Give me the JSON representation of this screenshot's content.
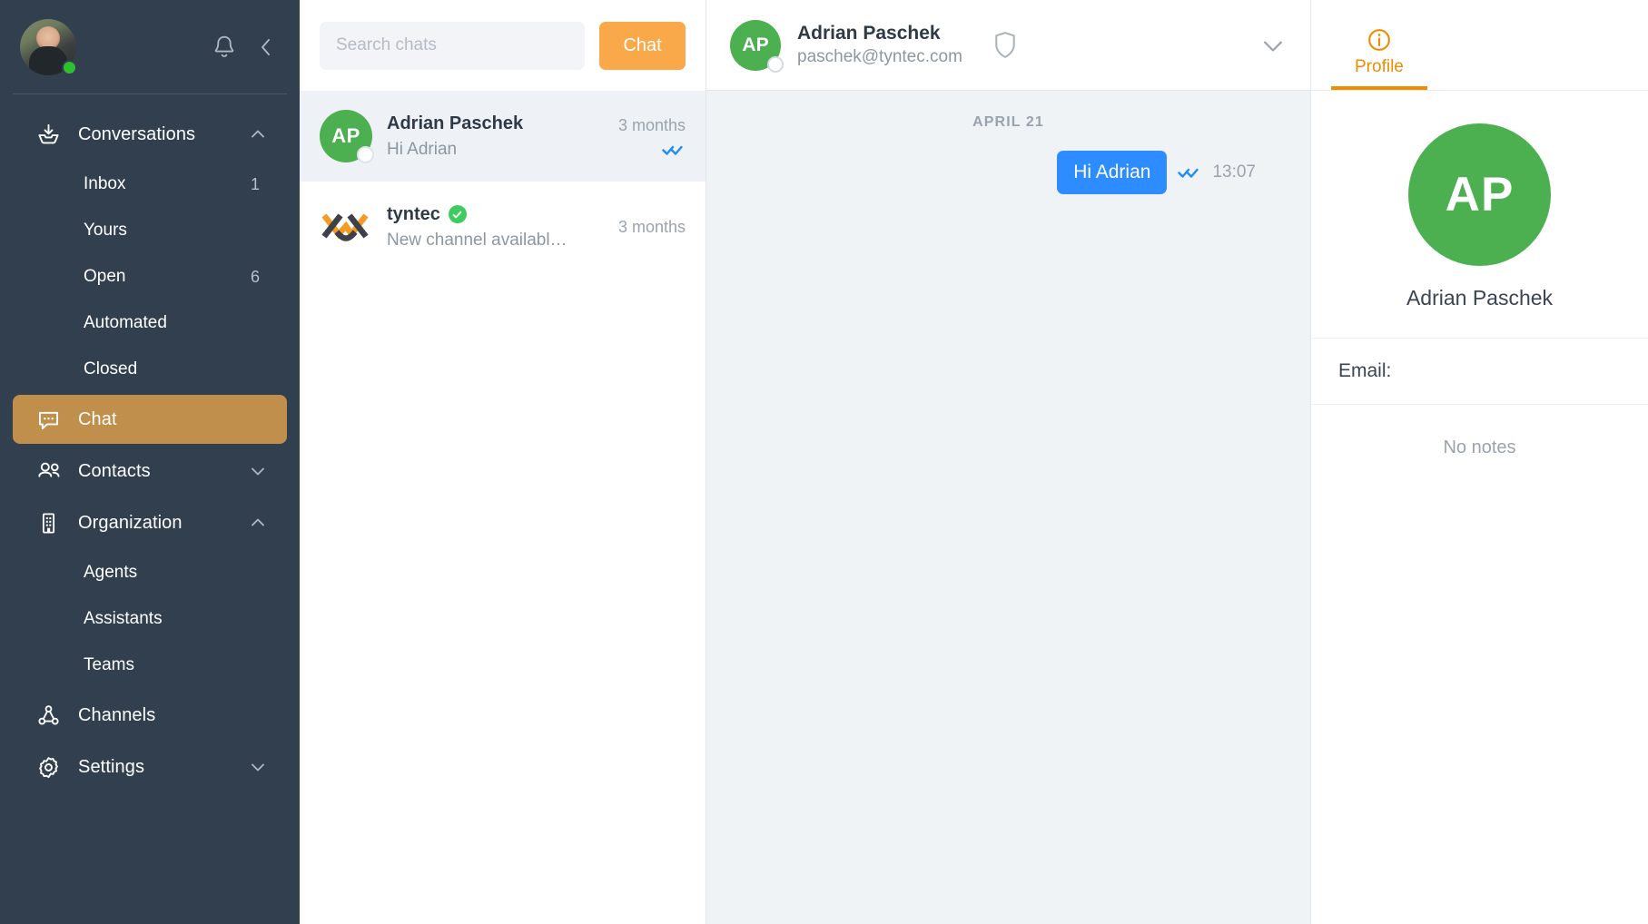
{
  "sidebar": {
    "user": {
      "presence": "online"
    },
    "icons": {
      "bell": "bell-icon",
      "collapse": "chevron-left-icon"
    },
    "groups": [
      {
        "label": "Conversations",
        "icon": "inbox-download-icon",
        "expanded": true,
        "children": [
          {
            "label": "Inbox",
            "count": "1"
          },
          {
            "label": "Yours",
            "count": ""
          },
          {
            "label": "Open",
            "count": "6"
          },
          {
            "label": "Automated",
            "count": ""
          },
          {
            "label": "Closed",
            "count": ""
          }
        ]
      }
    ],
    "items": [
      {
        "label": "Chat",
        "icon": "chat-bubble-icon",
        "active": true
      },
      {
        "label": "Contacts",
        "icon": "people-icon",
        "chevron": "down"
      },
      {
        "label": "Organization",
        "icon": "building-icon",
        "chevron": "up"
      }
    ],
    "org_children": [
      {
        "label": "Agents"
      },
      {
        "label": "Assistants"
      },
      {
        "label": "Teams"
      }
    ],
    "bottom_items": [
      {
        "label": "Channels",
        "icon": "channels-icon",
        "chevron": ""
      },
      {
        "label": "Settings",
        "icon": "gear-icon",
        "chevron": "down"
      }
    ],
    "active_color": "#C08F4C",
    "background": "#323F4F"
  },
  "chatlist": {
    "search_placeholder": "Search chats",
    "search_value": "",
    "new_chat_label": "Chat",
    "new_chat_color": "#F9A949",
    "items": [
      {
        "initials": "AP",
        "name": "Adrian Paschek",
        "preview": "Hi Adrian",
        "time": "3 months",
        "selected": true,
        "read_receipt": "double-check-blue",
        "verified": false,
        "avatar_color": "#4CAF50"
      },
      {
        "initials": "",
        "name": "tyntec",
        "preview": "New channel availabl…",
        "time": "3 months",
        "selected": false,
        "read_receipt": "",
        "verified": true,
        "avatar_color": ""
      }
    ]
  },
  "conversation": {
    "header": {
      "initials": "AP",
      "name": "Adrian Paschek",
      "subtitle": "paschek@tyntec.com",
      "shield_icon": "shield-icon",
      "chevron_icon": "chevron-down-icon",
      "avatar_color": "#4CAF50"
    },
    "date_separator": "APRIL 21",
    "messages": [
      {
        "text": "Hi Adrian",
        "time": "13:07",
        "direction": "outgoing",
        "status": "double-check-blue",
        "bubble_color": "#2D8CFF"
      }
    ],
    "background": "#EFF3F6"
  },
  "profile": {
    "tabs": [
      {
        "label": "Profile",
        "icon": "info-circle-icon",
        "active": true
      }
    ],
    "accent_color": "#F08C00",
    "initials": "AP",
    "name": "Adrian Paschek",
    "avatar_color": "#4CAF50",
    "fields": [
      {
        "label": "Email:",
        "value": ""
      }
    ],
    "notes_empty": "No notes"
  }
}
